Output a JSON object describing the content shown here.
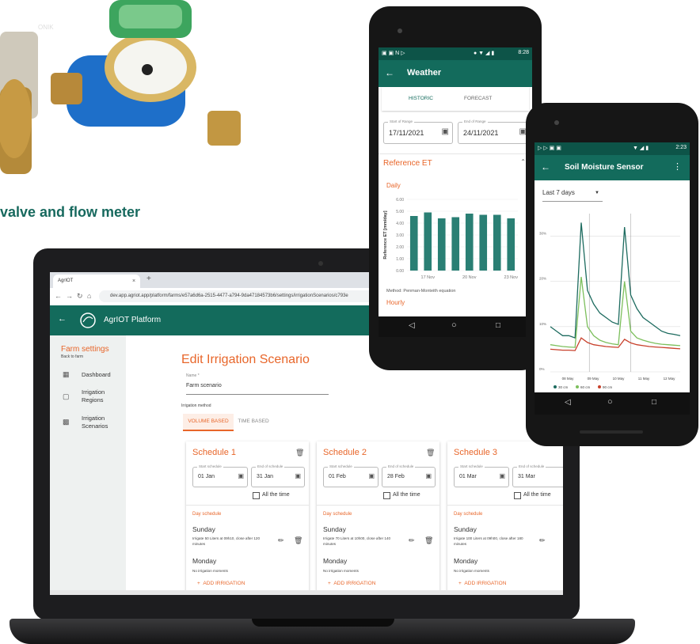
{
  "product": {
    "watermark": "ONIK",
    "caption": "valve and flow meter"
  },
  "laptop": {
    "browser": {
      "tab_title": "AgrIOT",
      "tab_close": "×",
      "new_tab": "+",
      "url": "dev.app.agriot.app/platform/farms/e57a6d6a-2515-4477-a794-9da47184573b6/settings/irrigationScenarios/c793e"
    },
    "app": {
      "title": "AgrIOT Platform"
    },
    "sidebar": {
      "title": "Farm settings",
      "back": "Back to farm",
      "items": [
        {
          "label": "Dashboard"
        },
        {
          "label": "Irrigation Regions"
        },
        {
          "label": "Irrigation Scenarios"
        }
      ]
    },
    "form": {
      "title": "Edit Irrigation Scenario",
      "name_label": "Name *",
      "name_value": "Farm scenario",
      "method_label": "Irrigation method",
      "method_tabs": [
        "VOLUME BASED",
        "TIME BASED"
      ]
    },
    "schedules": [
      {
        "title": "Schedule 1",
        "start_label": "Start schedule",
        "start": "01 Jan",
        "end_label": "End of schedule",
        "end": "31 Jan",
        "all_time": "All the time",
        "day_header": "Day schedule",
        "day1": "Sunday",
        "day1_note": "Irrigate 50 Liters at 09h10, close after 120 minutes",
        "day2": "Monday",
        "day2_note": "No irrigation moments",
        "add": "ADD IRRIGATION"
      },
      {
        "title": "Schedule 2",
        "start_label": "Start schedule",
        "start": "01 Feb",
        "end_label": "End of schedule",
        "end": "28 Feb",
        "all_time": "All the time",
        "day_header": "Day schedule",
        "day1": "Sunday",
        "day1_note": "Irrigate 70 Liters at 10h00, close after 140 minutes",
        "day2": "Monday",
        "day2_note": "No irrigation moments",
        "add": "ADD IRRIGATION"
      },
      {
        "title": "Schedule 3",
        "start_label": "Start schedule",
        "start": "01 Mar",
        "end_label": "End of schedule",
        "end": "31 Mar",
        "all_time": "All the time",
        "day_header": "Day schedule",
        "day1": "Sunday",
        "day1_note": "Irrigate 100 Liters at 09h00, close after 180 minutes",
        "day2": "Monday",
        "day2_note": "No irrigation moments",
        "add": "ADD IRRIGATION"
      }
    ]
  },
  "phone_weather": {
    "status_time": "8:28",
    "title": "Weather",
    "tabs": [
      "HISTORIC",
      "FORECAST"
    ],
    "start_label": "Start of Range",
    "start_value": "17/11/2021",
    "end_label": "End of Range",
    "end_value": "24/11/2021",
    "section": "Reference ET",
    "subsection": "Daily",
    "method": "Method: Penman-Monteith equation",
    "footer": "Hourly"
  },
  "phone_soil": {
    "status_time": "2:23",
    "title": "Soil Moisture Sensor",
    "range": "Last 7 days"
  },
  "chart_data": [
    {
      "type": "bar",
      "ylabel": "Reference ET [mm/day]",
      "yticks": [
        "0.00",
        "1.00",
        "2.00",
        "3.00",
        "4.00",
        "5.00",
        "6.00"
      ],
      "ylim": [
        0,
        6
      ],
      "xticks": [
        "17 Nov",
        "20 Nov",
        "23 Nov"
      ],
      "values": [
        4.6,
        4.9,
        4.4,
        4.5,
        4.8,
        4.7,
        4.7,
        4.4
      ],
      "color": "#2a7f74"
    },
    {
      "type": "line",
      "yticks": [
        "0%",
        "10%",
        "20%",
        "30%"
      ],
      "ylim": [
        0,
        35
      ],
      "xticks": [
        "08 May",
        "09 May",
        "10 May",
        "11 May",
        "12 May"
      ],
      "series": [
        {
          "name": "30 cm",
          "color": "#1d6b5f",
          "values": [
            10,
            9,
            8,
            8,
            7.5,
            33,
            18,
            15,
            13,
            12,
            11,
            10.5,
            32,
            17,
            14,
            12,
            11,
            10,
            9,
            8.5,
            8.3,
            8
          ]
        },
        {
          "name": "60 cm",
          "color": "#7cbf5c",
          "values": [
            6,
            5.8,
            5.6,
            5.5,
            5.4,
            21,
            10,
            8,
            7,
            6.5,
            6.2,
            6,
            20,
            9,
            7.5,
            7,
            6.6,
            6.3,
            6.1,
            6,
            5.9,
            5.8
          ]
        },
        {
          "name": "90 cm",
          "color": "#c8402b",
          "values": [
            5,
            4.9,
            4.8,
            4.8,
            4.7,
            7.5,
            6.5,
            6,
            5.8,
            5.6,
            5.5,
            5.4,
            7.2,
            6.4,
            6,
            5.8,
            5.6,
            5.5,
            5.4,
            5.3,
            5.2,
            5.1
          ]
        }
      ]
    }
  ]
}
